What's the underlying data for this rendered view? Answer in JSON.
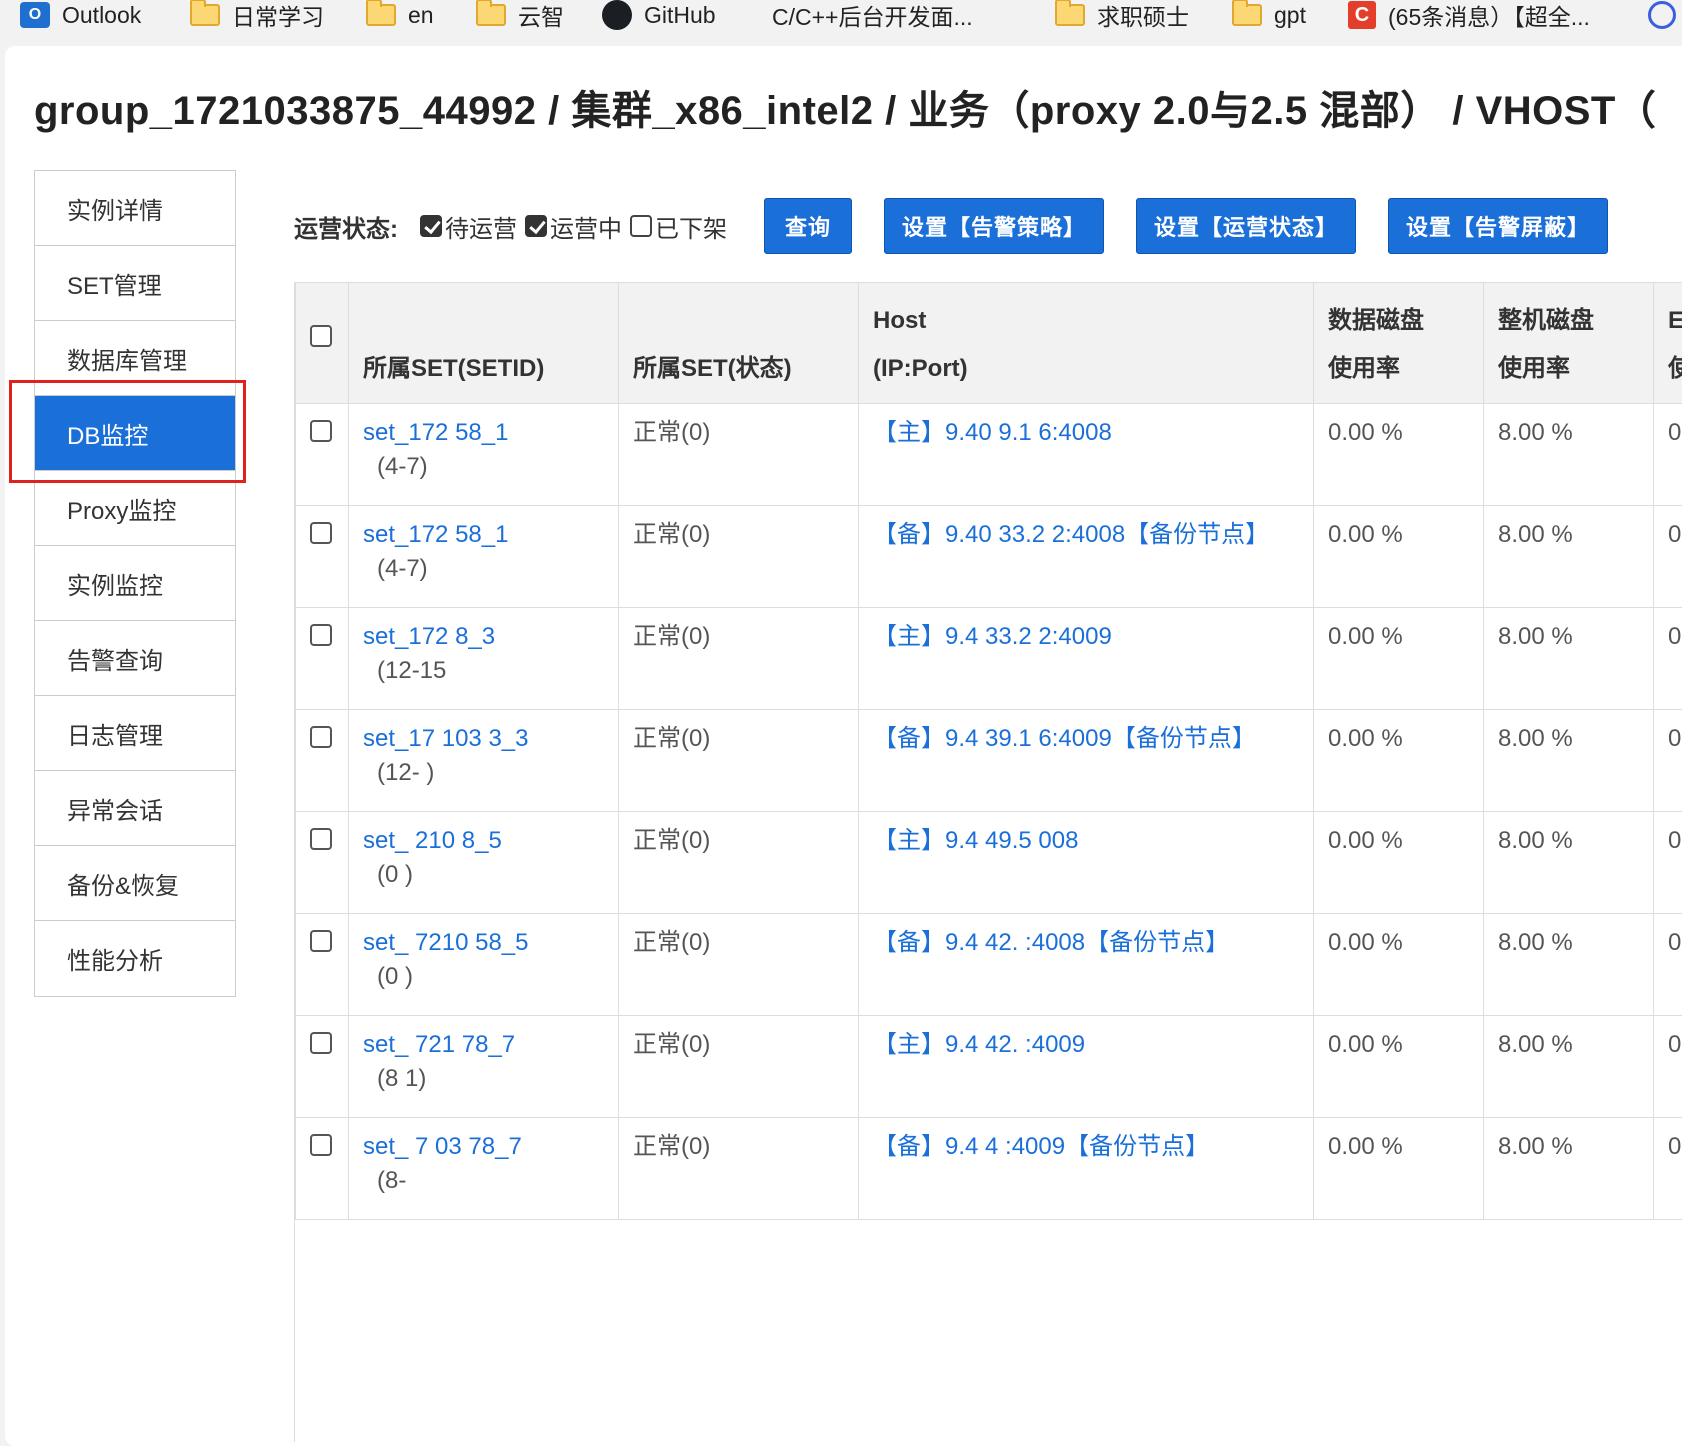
{
  "bookmarks": [
    {
      "label": "Outlook",
      "icon": "outlook-icon"
    },
    {
      "label": "日常学习",
      "icon": "folder-icon"
    },
    {
      "label": "en",
      "icon": "folder-icon"
    },
    {
      "label": "云智",
      "icon": "folder-icon"
    },
    {
      "label": "GitHub",
      "icon": "github-icon"
    },
    {
      "label": "C/C++后台开发面...",
      "icon": "avatar-icon"
    },
    {
      "label": "求职硕士",
      "icon": "folder-icon"
    },
    {
      "label": "gpt",
      "icon": "folder-icon"
    },
    {
      "label": "(65条消息）【超全...",
      "icon": "csdn-icon"
    }
  ],
  "breadcrumb": "group_1721033875_44992 / 集群_x86_intel2 / 业务（proxy 2.0与2.5 混部） /  VHOST（",
  "sidebar": {
    "items": [
      {
        "label": "实例详情"
      },
      {
        "label": "SET管理"
      },
      {
        "label": "数据库管理"
      },
      {
        "label": "DB监控"
      },
      {
        "label": "Proxy监控"
      },
      {
        "label": "实例监控"
      },
      {
        "label": "告警查询"
      },
      {
        "label": "日志管理"
      },
      {
        "label": "异常会话"
      },
      {
        "label": "备份&恢复"
      },
      {
        "label": "性能分析"
      }
    ],
    "active": "DB监控"
  },
  "filter": {
    "label": "运营状态:",
    "options": [
      {
        "label": "待运营",
        "checked": true
      },
      {
        "label": "运营中",
        "checked": true
      },
      {
        "label": "已下架",
        "checked": false
      }
    ]
  },
  "buttons": {
    "query": "查询",
    "alarm_policy": "设置【告警策略】",
    "op_status": "设置【运营状态】",
    "alarm_mask": "设置【告警屏蔽】"
  },
  "table": {
    "headers": {
      "set_id": "所属SET(SETID)",
      "set_status": "所属SET(状态)",
      "host_line1": "Host",
      "host_line2": "(IP:Port)",
      "data_disk_line1": "数据磁盘",
      "data_disk_line2": "使用率",
      "machine_disk_line1": "整机磁盘",
      "machine_disk_line2": "使用率",
      "next_line1": "E",
      "next_line2": "使"
    },
    "rows": [
      {
        "set": "set_172      58_1",
        "range": "(4-7)",
        "status": "正常(0)",
        "host": "【主】9.40    9.1   6:4008",
        "data_disk": "0.00 %",
        "machine_disk": "8.00 %",
        "next": "0."
      },
      {
        "set": "set_172      58_1",
        "range": "(4-7)",
        "status": "正常(0)",
        "host": "【备】9.40   33.2  2:4008【备份节点】",
        "data_disk": "0.00 %",
        "machine_disk": "8.00 %",
        "next": "0."
      },
      {
        "set": "set_172      8_3",
        "range": "(12-15",
        "status": "正常(0)",
        "host": "【主】9.4    33.2  2:4009",
        "data_disk": "0.00 %",
        "machine_disk": "8.00 %",
        "next": "0."
      },
      {
        "set": "set_17  103   3_3",
        "range": "(12-   )",
        "status": "正常(0)",
        "host": "【备】9.4    39.1  6:4009【备份节点】",
        "data_disk": "0.00 %",
        "machine_disk": "8.00 %",
        "next": "0."
      },
      {
        "set": "set_   210   8_5",
        "range": "(0  )",
        "status": "正常(0)",
        "host": "【主】9.4   49.5  008",
        "data_disk": "0.00 %",
        "machine_disk": "8.00 %",
        "next": "0."
      },
      {
        "set": "set_  7210   58_5",
        "range": "(0  )",
        "status": "正常(0)",
        "host": "【备】9.4   42.   :4008【备份节点】",
        "data_disk": "0.00 %",
        "machine_disk": "8.00 %",
        "next": "0."
      },
      {
        "set": "set_  721   78_7",
        "range": "(8  1)",
        "status": "正常(0)",
        "host": "【主】9.4   42.   :4009",
        "data_disk": "0.00 %",
        "machine_disk": "8.00 %",
        "next": "0."
      },
      {
        "set": "set_  7  03   78_7",
        "range": "(8-",
        "status": "正常(0)",
        "host": "【备】9.4   4   :4009【备份节点】",
        "data_disk": "0.00 %",
        "machine_disk": "8.00 %",
        "next": "0."
      }
    ]
  },
  "colors": {
    "accent": "#1a6fd8",
    "highlight": "#e0221e"
  }
}
